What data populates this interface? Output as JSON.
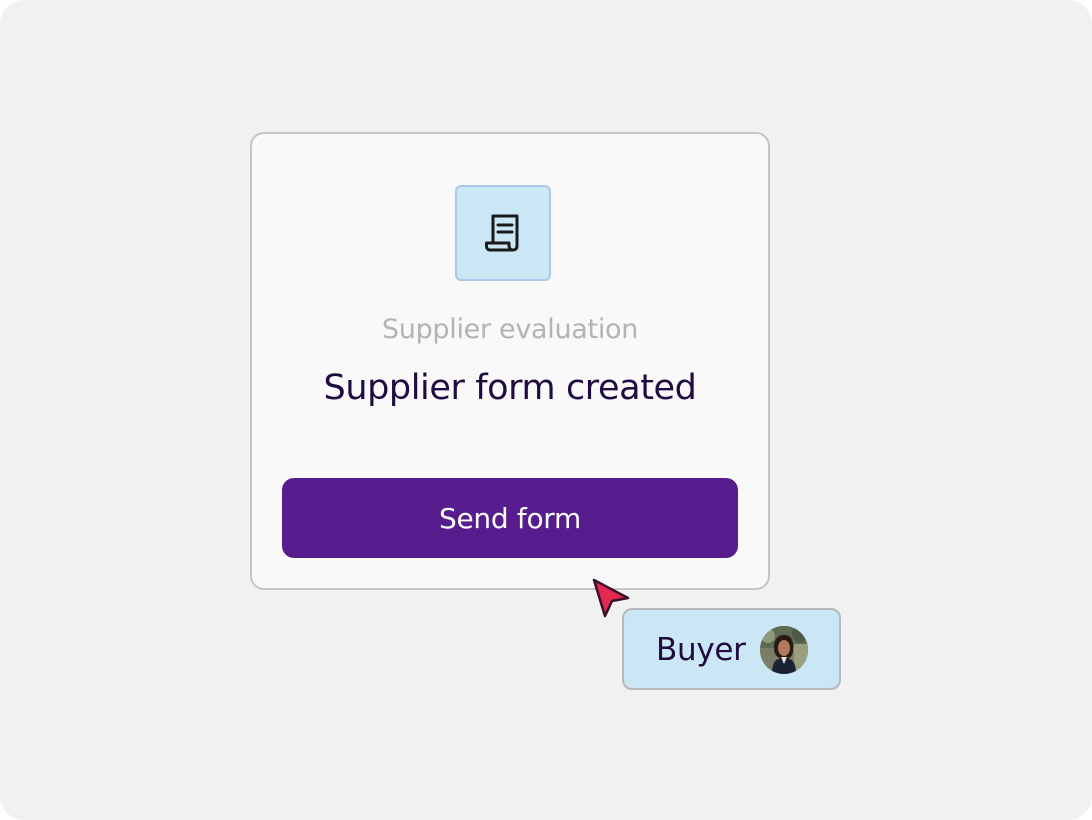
{
  "card": {
    "icon": "document-icon",
    "subtitle": "Supplier evaluation",
    "title": "Supplier form created",
    "send_button_label": "Send form"
  },
  "cursor": {
    "icon": "pointer-cursor-icon",
    "color": "#e3294f"
  },
  "buyer_chip": {
    "label": "Buyer",
    "avatar": "user-avatar"
  },
  "colors": {
    "background": "#f2f1f1",
    "card_background": "#f9f9f9",
    "icon_tile": "#cbe6f5",
    "primary_button": "#571c8d",
    "heading_text": "#1f0b40",
    "muted_text": "#b3b2b5"
  }
}
